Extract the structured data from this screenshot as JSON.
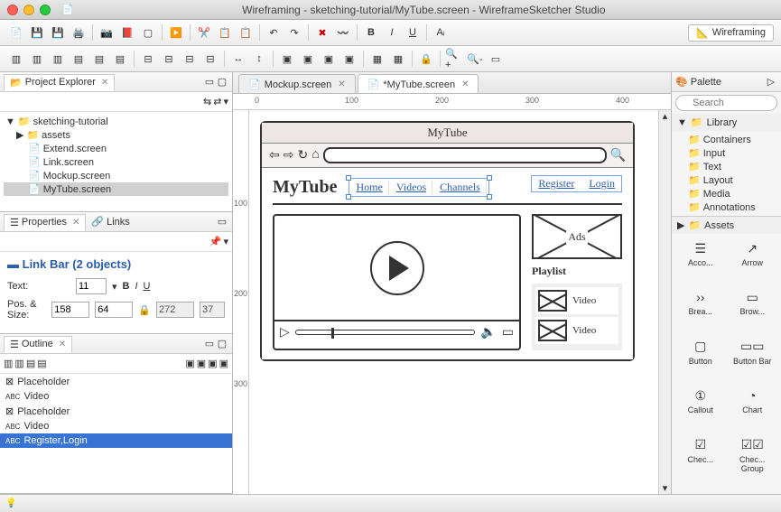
{
  "window": {
    "title": "Wireframing - sketching-tutorial/MyTube.screen - WireframeSketcher Studio"
  },
  "perspective": {
    "label": "Wireframing"
  },
  "topToolbar": {
    "bold": "B",
    "italic": "I",
    "underline": "U"
  },
  "projectExplorer": {
    "title": "Project Explorer",
    "items": [
      {
        "label": "sketching-tutorial",
        "type": "folder",
        "indent": 0,
        "expand": "▼"
      },
      {
        "label": "assets",
        "type": "folder",
        "indent": 1,
        "expand": "▶"
      },
      {
        "label": "Extend.screen",
        "type": "file",
        "indent": 1
      },
      {
        "label": "Link.screen",
        "type": "file",
        "indent": 1
      },
      {
        "label": "Mockup.screen",
        "type": "file",
        "indent": 1
      },
      {
        "label": "MyTube.screen",
        "type": "file",
        "indent": 1,
        "selected": true
      }
    ]
  },
  "properties": {
    "tabTitle": "Properties",
    "linksTab": "Links",
    "heading": "Link Bar (2 objects)",
    "textLabel": "Text:",
    "fontSize": "11",
    "posLabel": "Pos. & Size:",
    "x": "158",
    "y": "64",
    "w": "272",
    "h": "37"
  },
  "outline": {
    "title": "Outline",
    "items": [
      {
        "icon": "ph",
        "label": "Placeholder"
      },
      {
        "icon": "abc",
        "label": "Video"
      },
      {
        "icon": "ph",
        "label": "Placeholder"
      },
      {
        "icon": "abc",
        "label": "Video"
      },
      {
        "icon": "abc",
        "label": "Register,Login",
        "selected": true
      }
    ]
  },
  "editorTabs": [
    {
      "label": "Mockup.screen",
      "active": false
    },
    {
      "label": "*MyTube.screen",
      "active": true
    }
  ],
  "ruler": {
    "t0": "0",
    "t100": "100",
    "t200": "200",
    "t300": "300",
    "t400": "400",
    "v100": "100",
    "v200": "200",
    "v300": "300"
  },
  "mockup": {
    "browserTitle": "MyTube",
    "logo": "MyTube",
    "links": [
      "Home",
      "Videos",
      "Channels"
    ],
    "auth": [
      "Register",
      "Login"
    ],
    "ads": "Ads",
    "playlistTitle": "Playlist",
    "playlist": [
      "Video",
      "Video"
    ]
  },
  "palette": {
    "title": "Palette",
    "searchPlaceholder": "Search",
    "library": "Library",
    "folders": [
      "Containers",
      "Input",
      "Text",
      "Layout",
      "Media",
      "Annotations"
    ],
    "assets": "Assets",
    "items": [
      {
        "label": "Acco..."
      },
      {
        "label": "Arrow"
      },
      {
        "label": "Brea..."
      },
      {
        "label": "Brow..."
      },
      {
        "label": "Button"
      },
      {
        "label": "Button Bar"
      },
      {
        "label": "Callout"
      },
      {
        "label": "Chart"
      },
      {
        "label": "Chec..."
      },
      {
        "label": "Chec... Group"
      }
    ]
  }
}
